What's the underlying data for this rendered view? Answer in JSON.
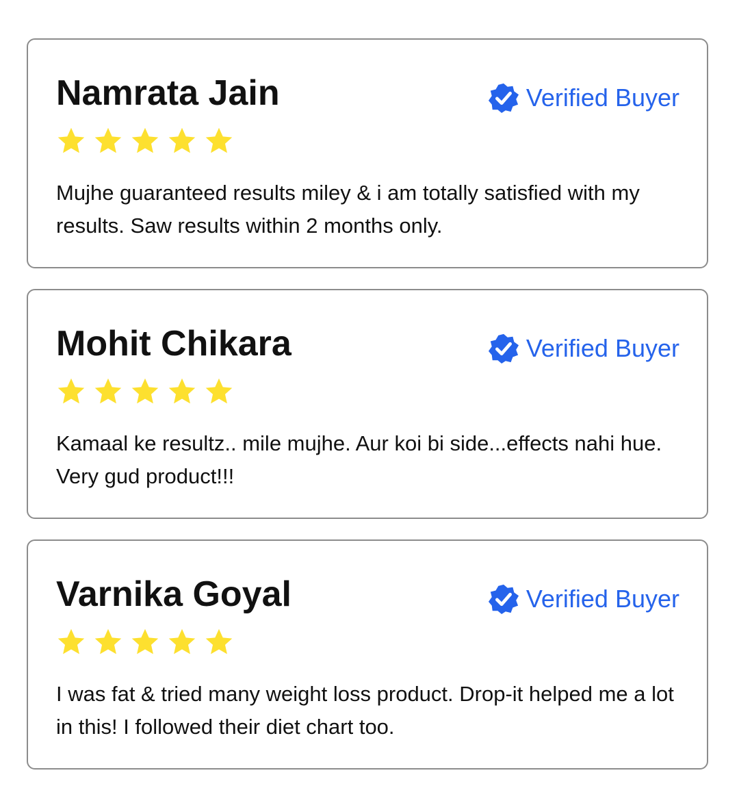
{
  "colors": {
    "accent": "#2563eb",
    "star": "#fde02f",
    "border": "#8c8c8c",
    "text": "#111111"
  },
  "reviews": [
    {
      "name": "Namrata Jain",
      "badge_label": "Verified Buyer",
      "badge_icon": "verified-check-icon",
      "rating": 5,
      "max_rating": 5,
      "text": "Mujhe guaranteed results miley & i am totally satisfied with my results. Saw results within 2 months only."
    },
    {
      "name": "Mohit Chikara",
      "badge_label": "Verified Buyer",
      "badge_icon": "verified-check-icon",
      "rating": 5,
      "max_rating": 5,
      "text": "Kamaal ke resultz.. mile mujhe. Aur koi bi side...effects nahi hue. Very gud product!!!"
    },
    {
      "name": "Varnika Goyal",
      "badge_label": "Verified Buyer",
      "badge_icon": "verified-check-icon",
      "rating": 5,
      "max_rating": 5,
      "text": "I was fat & tried many weight loss product. Drop-it helped me a lot in this! I followed their diet chart too."
    }
  ]
}
